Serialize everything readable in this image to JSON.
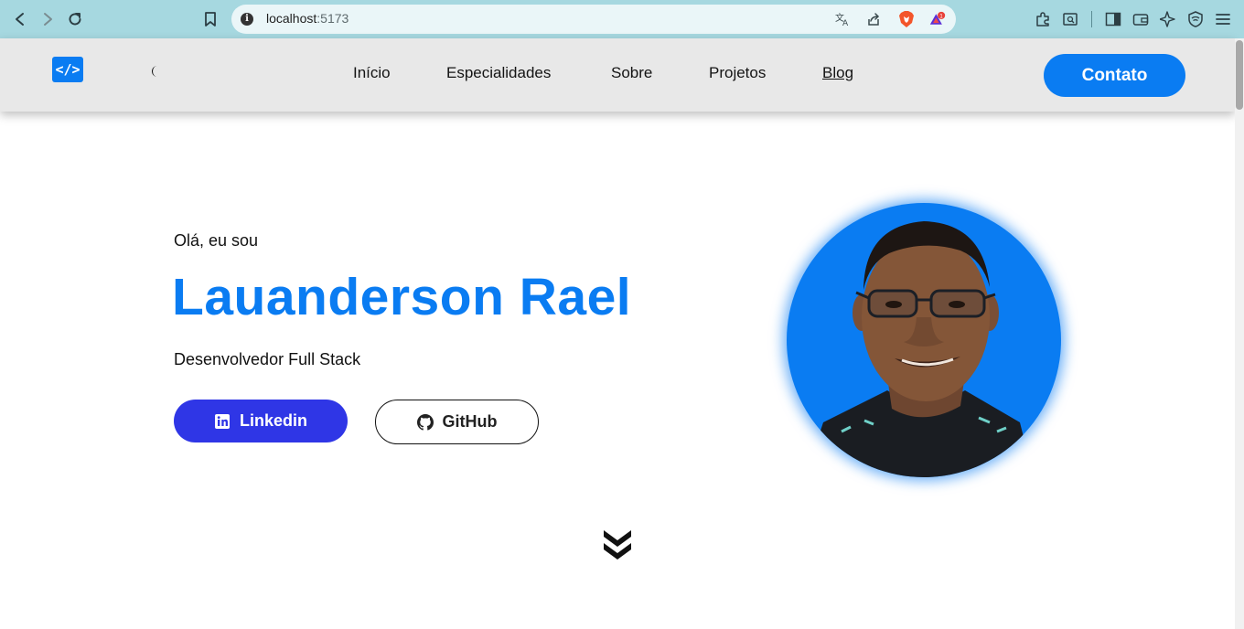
{
  "browser": {
    "url_host": "localhost",
    "url_port": ":5173",
    "brave_badge": "1"
  },
  "header": {
    "logo_text": "</>",
    "nav_items": [
      {
        "label": "Início"
      },
      {
        "label": "Especialidades"
      },
      {
        "label": "Sobre"
      },
      {
        "label": "Projetos"
      },
      {
        "label": "Blog"
      }
    ],
    "contact_label": "Contato"
  },
  "hero": {
    "greeting": "Olá, eu sou",
    "name": "Lauanderson Rael",
    "role": "Desenvolvedor Full Stack",
    "linkedin_label": "Linkedin",
    "github_label": "GitHub"
  },
  "colors": {
    "accent": "#0a7cf2",
    "linkedin_button": "#2f36e6",
    "header_bg": "#e8e8e8",
    "browser_bar": "#a6d8e0"
  },
  "icons": {
    "back": "back-arrow-icon",
    "forward": "forward-arrow-icon",
    "reload": "reload-icon",
    "bookmark": "bookmark-icon",
    "theme": "moon-icon",
    "scroll": "double-chevron-down-icon"
  }
}
